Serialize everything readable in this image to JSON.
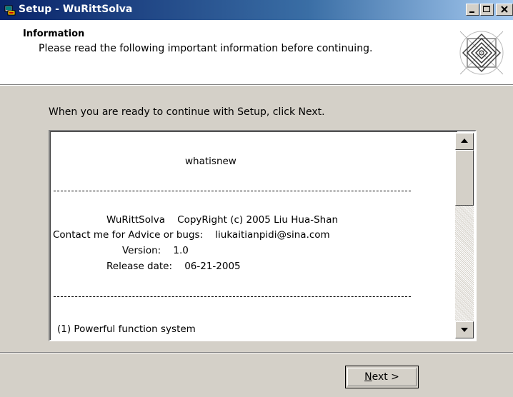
{
  "window": {
    "title": "Setup - WuRittSolva",
    "controls": [
      "minimize",
      "maximize",
      "close"
    ]
  },
  "header": {
    "title": "Information",
    "subtitle": "Please read the following important information before continuing."
  },
  "instruction": "When you are ready to continue with Setup, click Next.",
  "memo": {
    "lines": [
      "whatisnew",
      "WuRittSolva    CopyRight (c) 2005 Liu Hua-Shan",
      "Contact me for Advice or bugs:    liukaitianpidi@sina.com",
      "Version:    1.0",
      "Release date:    06-21-2005",
      "(1) Powerful function system"
    ]
  },
  "buttons": {
    "next": "Next >"
  },
  "colors": {
    "titlebar_start": "#0a246a",
    "titlebar_end": "#a6caf0",
    "dialog_bg": "#d4d0c8"
  }
}
